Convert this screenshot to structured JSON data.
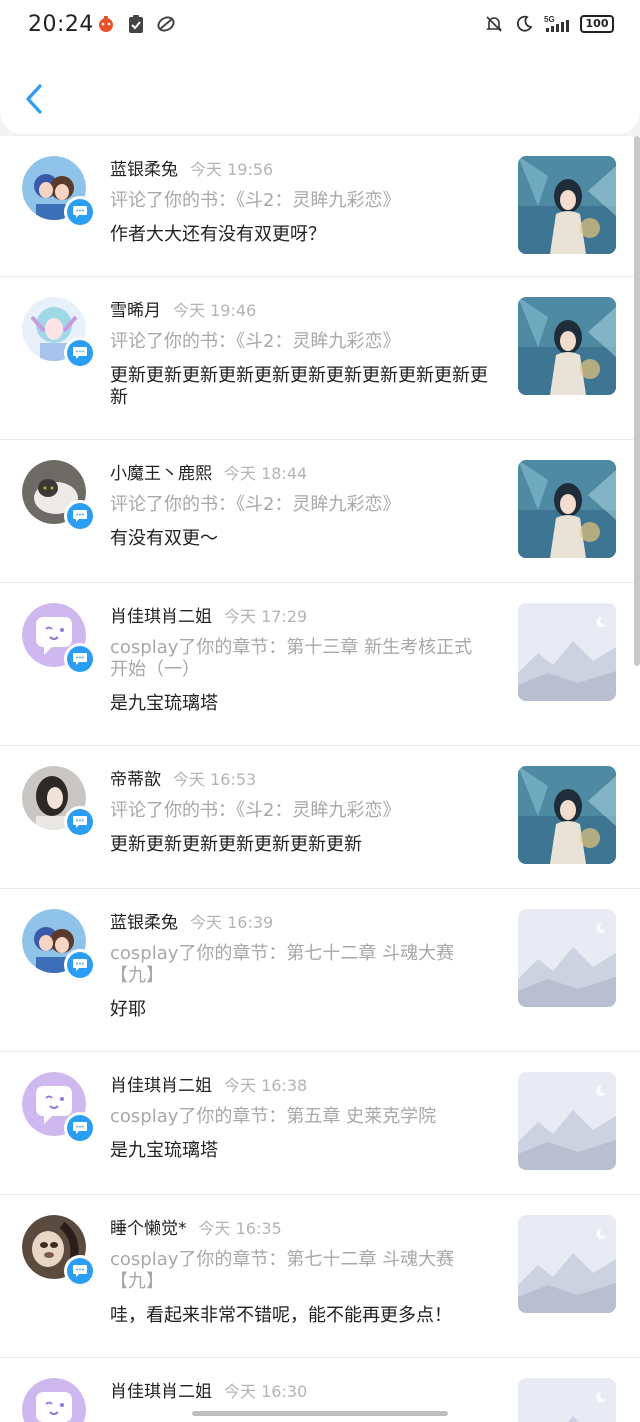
{
  "status": {
    "time": "20:24",
    "battery": "100",
    "signal": "5G"
  },
  "colors": {
    "accent": "#2a9ef5",
    "muted": "#a8a8a8"
  },
  "items": [
    {
      "name": "蓝银柔兔",
      "time": "今天 19:56",
      "action": "评论了你的书：《斗2：灵眸九彩恋》",
      "comment": "作者大大还有没有双更呀？",
      "avatar": "anime-couple",
      "thumb": "book-cover"
    },
    {
      "name": "雪晞月",
      "time": "今天 19:46",
      "action": "评论了你的书：《斗2：灵眸九彩恋》",
      "comment": "更新更新更新更新更新更新更新更新更新更新更新",
      "avatar": "anime-girl-blue",
      "thumb": "book-cover"
    },
    {
      "name": "小魔王丶鹿熙",
      "time": "今天 18:44",
      "action": "评论了你的书：《斗2：灵眸九彩恋》",
      "comment": "有没有双更～",
      "avatar": "cat-photo",
      "thumb": "book-cover"
    },
    {
      "name": "肖佳琪肖二姐",
      "time": "今天 17:29",
      "action": "cosplay了你的章节：第十三章 新生考核正式开始（一）",
      "comment": "是九宝琉璃塔",
      "avatar": "default-purple",
      "thumb": "placeholder"
    },
    {
      "name": "帝蒂歆",
      "time": "今天 16:53",
      "action": "评论了你的书：《斗2：灵眸九彩恋》",
      "comment": "更新更新更新更新更新更新更新",
      "avatar": "girl-photo",
      "thumb": "book-cover"
    },
    {
      "name": "蓝银柔兔",
      "time": "今天 16:39",
      "action": "cosplay了你的章节：第七十二章 斗魂大赛【九】",
      "comment": "好耶",
      "avatar": "anime-couple",
      "thumb": "placeholder"
    },
    {
      "name": "肖佳琪肖二姐",
      "time": "今天 16:38",
      "action": "cosplay了你的章节：第五章 史莱克学院",
      "comment": "是九宝琉璃塔",
      "avatar": "default-purple",
      "thumb": "placeholder"
    },
    {
      "name": "睡个懒觉*",
      "time": "今天 16:35",
      "action": "cosplay了你的章节：第七十二章 斗魂大赛【九】",
      "comment": "哇，看起来非常不错呢，能不能再更多点！",
      "avatar": "dog-photo",
      "thumb": "placeholder"
    },
    {
      "name": "肖佳琪肖二姐",
      "time": "今天 16:30",
      "action": "",
      "comment": "",
      "avatar": "default-purple",
      "thumb": "placeholder"
    }
  ]
}
